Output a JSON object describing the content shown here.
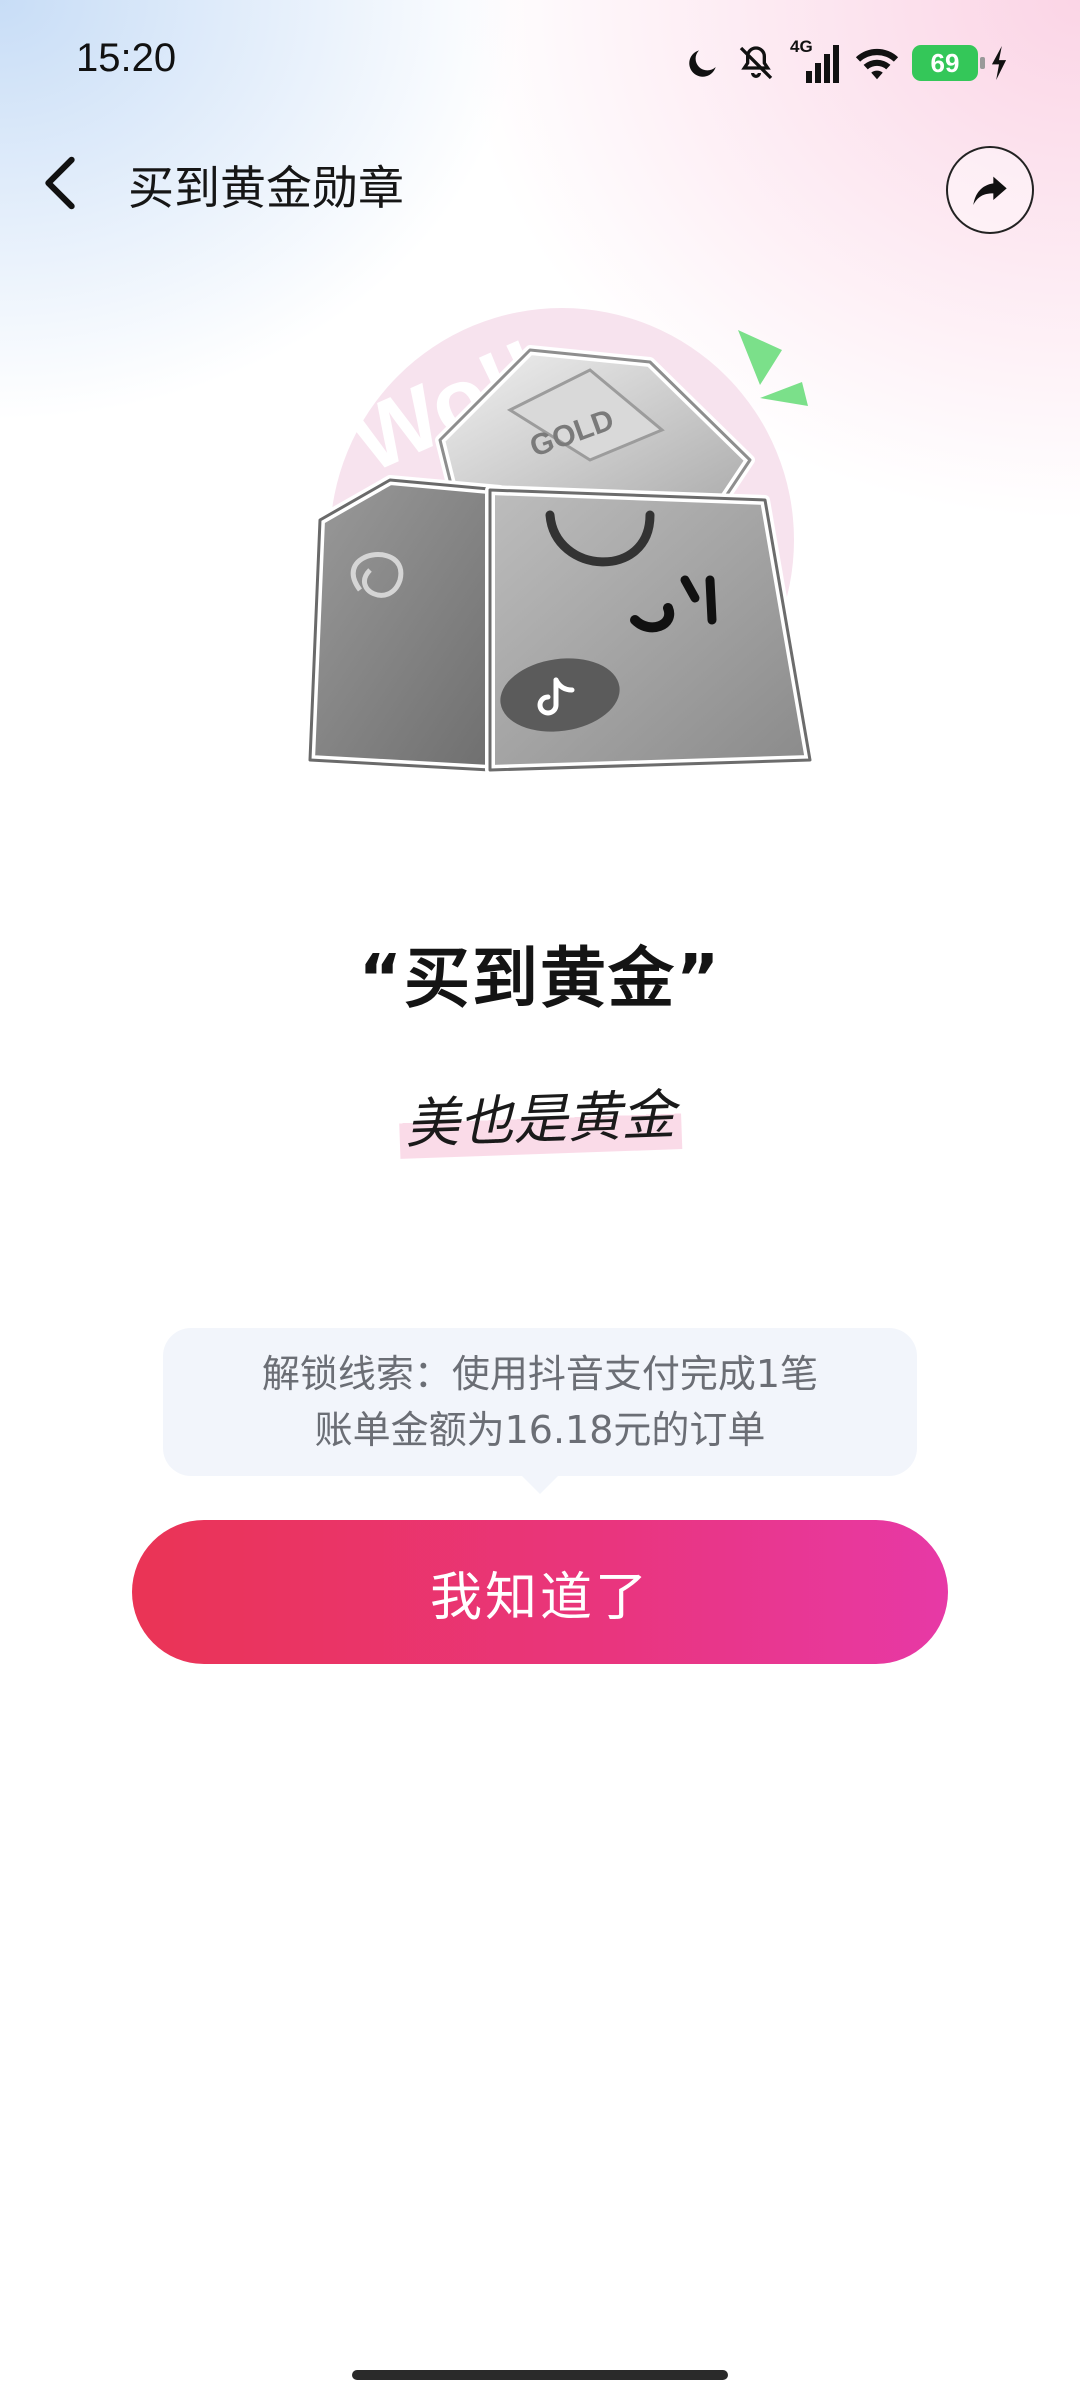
{
  "status_bar": {
    "time": "15:20",
    "network": "4G",
    "battery": "69",
    "icons": [
      "moon-icon",
      "mute-icon",
      "signal-icon",
      "wifi-icon",
      "battery-icon",
      "charging-icon"
    ]
  },
  "header": {
    "title": "买到黄金勋章",
    "back_icon": "back-arrow-icon",
    "share_icon": "share-icon"
  },
  "badge": {
    "image_label": "GOLD",
    "name": "“买到黄金”",
    "slogan": "美也是黄金"
  },
  "hint": {
    "line1": "解锁线索：使用抖音支付完成1笔",
    "line2": "账单金额为16.18元的订单"
  },
  "actions": {
    "confirm_label": "我知道了"
  },
  "colors": {
    "button_start": "#ea3455",
    "button_end": "#e739a6",
    "battery": "#34c759",
    "hint_bg": "#f2f5fb"
  }
}
